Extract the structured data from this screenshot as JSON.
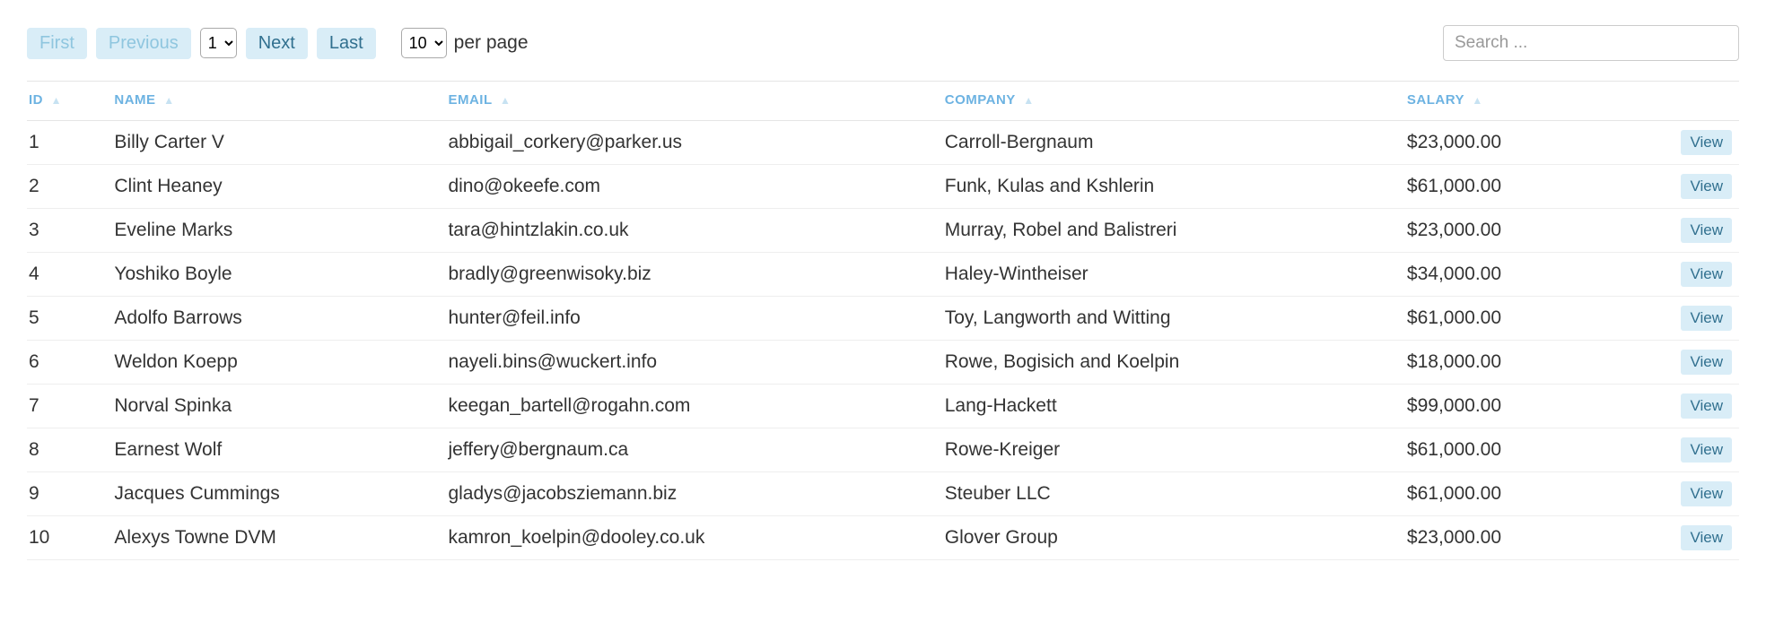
{
  "pagination": {
    "first_label": "First",
    "previous_label": "Previous",
    "next_label": "Next",
    "last_label": "Last",
    "current_page": "1",
    "per_page": "10",
    "per_page_label": "per page"
  },
  "search": {
    "placeholder": "Search ..."
  },
  "table": {
    "columns": {
      "id": "ID",
      "name": "NAME",
      "email": "EMAIL",
      "company": "COMPANY",
      "salary": "SALARY"
    },
    "view_label": "View",
    "rows": [
      {
        "id": "1",
        "name": "Billy Carter V",
        "email": "abbigail_corkery@parker.us",
        "company": "Carroll-Bergnaum",
        "salary": "$23,000.00"
      },
      {
        "id": "2",
        "name": "Clint Heaney",
        "email": "dino@okeefe.com",
        "company": "Funk, Kulas and Kshlerin",
        "salary": "$61,000.00"
      },
      {
        "id": "3",
        "name": "Eveline Marks",
        "email": "tara@hintzlakin.co.uk",
        "company": "Murray, Robel and Balistreri",
        "salary": "$23,000.00"
      },
      {
        "id": "4",
        "name": "Yoshiko Boyle",
        "email": "bradly@greenwisoky.biz",
        "company": "Haley-Wintheiser",
        "salary": "$34,000.00"
      },
      {
        "id": "5",
        "name": "Adolfo Barrows",
        "email": "hunter@feil.info",
        "company": "Toy, Langworth and Witting",
        "salary": "$61,000.00"
      },
      {
        "id": "6",
        "name": "Weldon Koepp",
        "email": "nayeli.bins@wuckert.info",
        "company": "Rowe, Bogisich and Koelpin",
        "salary": "$18,000.00"
      },
      {
        "id": "7",
        "name": "Norval Spinka",
        "email": "keegan_bartell@rogahn.com",
        "company": "Lang-Hackett",
        "salary": "$99,000.00"
      },
      {
        "id": "8",
        "name": "Earnest Wolf",
        "email": "jeffery@bergnaum.ca",
        "company": "Rowe-Kreiger",
        "salary": "$61,000.00"
      },
      {
        "id": "9",
        "name": "Jacques Cummings",
        "email": "gladys@jacobsziemann.biz",
        "company": "Steuber LLC",
        "salary": "$61,000.00"
      },
      {
        "id": "10",
        "name": "Alexys Towne DVM",
        "email": "kamron_koelpin@dooley.co.uk",
        "company": "Glover Group",
        "salary": "$23,000.00"
      }
    ]
  }
}
